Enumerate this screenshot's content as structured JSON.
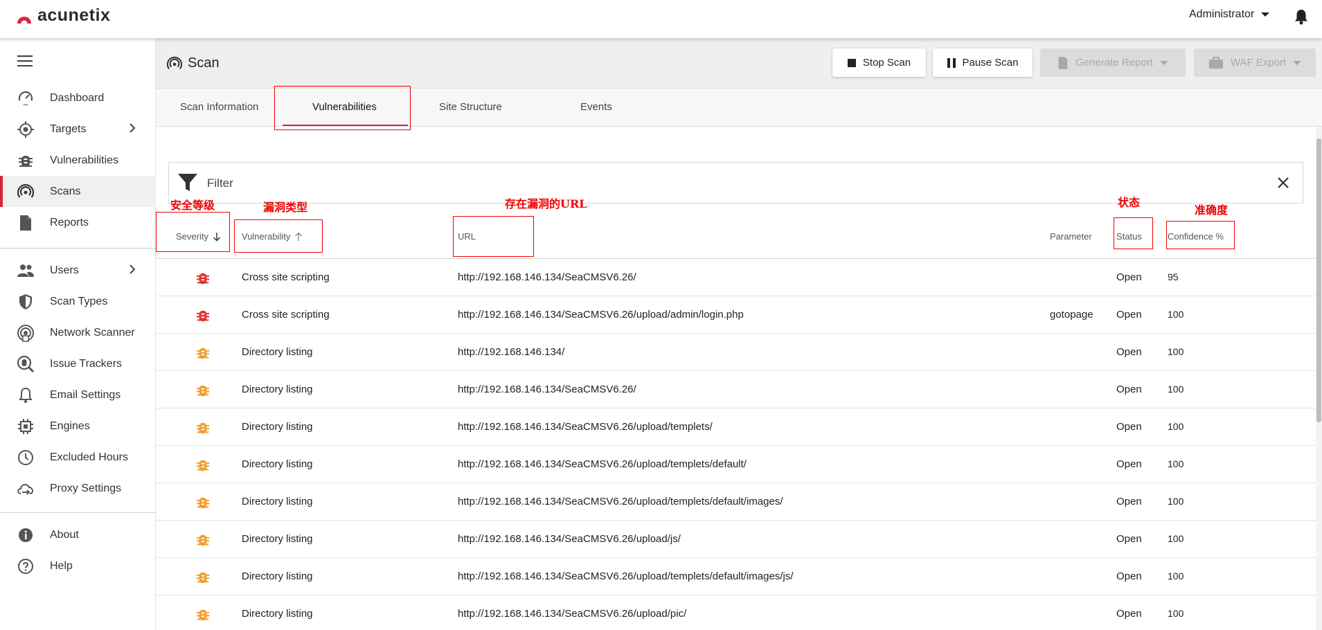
{
  "app": {
    "logo_text": "acunetix",
    "user": "Administrator"
  },
  "sidebar": {
    "items": [
      {
        "label": "Dashboard",
        "icon": "gauge-icon"
      },
      {
        "label": "Targets",
        "icon": "target-icon"
      },
      {
        "label": "Vulnerabilities",
        "icon": "bug-icon"
      },
      {
        "label": "Scans",
        "icon": "radar-icon"
      },
      {
        "label": "Reports",
        "icon": "report-icon"
      },
      {
        "label": "Users",
        "icon": "users-icon"
      },
      {
        "label": "Scan Types",
        "icon": "shield-icon"
      },
      {
        "label": "Network Scanner",
        "icon": "network-scanner-icon"
      },
      {
        "label": "Issue Trackers",
        "icon": "issue-tracker-icon"
      },
      {
        "label": "Email Settings",
        "icon": "bell-icon"
      },
      {
        "label": "Engines",
        "icon": "chip-icon"
      },
      {
        "label": "Excluded Hours",
        "icon": "clock-icon"
      },
      {
        "label": "Proxy Settings",
        "icon": "proxy-cloud-icon"
      },
      {
        "label": "About",
        "icon": "info-icon"
      },
      {
        "label": "Help",
        "icon": "help-icon"
      }
    ]
  },
  "page": {
    "title": "Scan"
  },
  "toolbar": {
    "stop": "Stop Scan",
    "pause": "Pause Scan",
    "report": "Generate Report",
    "waf": "WAF Export"
  },
  "tabs": [
    "Scan Information",
    "Vulnerabilities",
    "Site Structure",
    "Events"
  ],
  "filter": {
    "label": "Filter"
  },
  "annotations": {
    "severity": "安全等级",
    "vulnerability": "漏洞类型",
    "url": "存在漏洞的URL",
    "status": "状态",
    "confidence": "准确度"
  },
  "table": {
    "headers": {
      "severity": "Severity",
      "vulnerability": "Vulnerability",
      "url": "URL",
      "parameter": "Parameter",
      "status": "Status",
      "confidence": "Confidence %"
    },
    "rows": [
      {
        "severity": "high",
        "vulnerability": "Cross site scripting",
        "url": "http://192.168.146.134/SeaCMSV6.26/",
        "parameter": "",
        "status": "Open",
        "confidence": "95"
      },
      {
        "severity": "high",
        "vulnerability": "Cross site scripting",
        "url": "http://192.168.146.134/SeaCMSV6.26/upload/admin/login.php",
        "parameter": "gotopage",
        "status": "Open",
        "confidence": "100"
      },
      {
        "severity": "medium",
        "vulnerability": "Directory listing",
        "url": "http://192.168.146.134/",
        "parameter": "",
        "status": "Open",
        "confidence": "100"
      },
      {
        "severity": "medium",
        "vulnerability": "Directory listing",
        "url": "http://192.168.146.134/SeaCMSV6.26/",
        "parameter": "",
        "status": "Open",
        "confidence": "100"
      },
      {
        "severity": "medium",
        "vulnerability": "Directory listing",
        "url": "http://192.168.146.134/SeaCMSV6.26/upload/templets/",
        "parameter": "",
        "status": "Open",
        "confidence": "100"
      },
      {
        "severity": "medium",
        "vulnerability": "Directory listing",
        "url": "http://192.168.146.134/SeaCMSV6.26/upload/templets/default/",
        "parameter": "",
        "status": "Open",
        "confidence": "100"
      },
      {
        "severity": "medium",
        "vulnerability": "Directory listing",
        "url": "http://192.168.146.134/SeaCMSV6.26/upload/templets/default/images/",
        "parameter": "",
        "status": "Open",
        "confidence": "100"
      },
      {
        "severity": "medium",
        "vulnerability": "Directory listing",
        "url": "http://192.168.146.134/SeaCMSV6.26/upload/js/",
        "parameter": "",
        "status": "Open",
        "confidence": "100"
      },
      {
        "severity": "medium",
        "vulnerability": "Directory listing",
        "url": "http://192.168.146.134/SeaCMSV6.26/upload/templets/default/images/js/",
        "parameter": "",
        "status": "Open",
        "confidence": "100"
      },
      {
        "severity": "medium",
        "vulnerability": "Directory listing",
        "url": "http://192.168.146.134/SeaCMSV6.26/upload/pic/",
        "parameter": "",
        "status": "Open",
        "confidence": "100"
      }
    ]
  },
  "colors": {
    "brand_red": "#d6263b",
    "sev_high": "#e5322d",
    "sev_medium": "#f0a030"
  }
}
